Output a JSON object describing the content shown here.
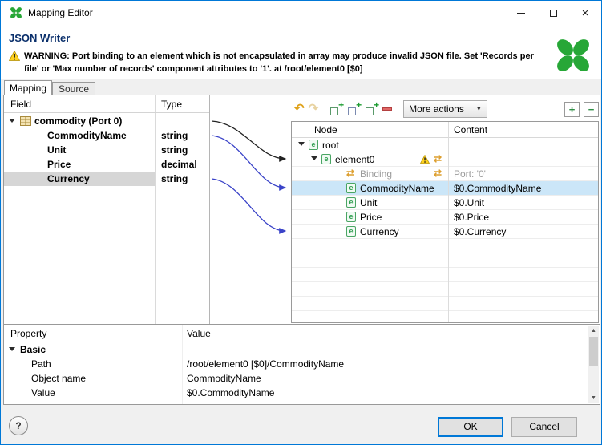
{
  "window": {
    "title": "Mapping Editor"
  },
  "header": {
    "title": "JSON Writer",
    "warning": "WARNING: Port binding to an element which is not encapsulated in array may produce invalid JSON file. Set 'Records per file' or 'Max number of records' component attributes to '1'. at /root/element0 [$0]"
  },
  "tabs": {
    "mapping": "Mapping",
    "source": "Source"
  },
  "left_table": {
    "col_field": "Field",
    "col_type": "Type",
    "root_label": "commodity (Port 0)",
    "rows": [
      {
        "field": "CommodityName",
        "type": "string"
      },
      {
        "field": "Unit",
        "type": "string"
      },
      {
        "field": "Price",
        "type": "decimal"
      },
      {
        "field": "Currency",
        "type": "string"
      }
    ]
  },
  "toolbar": {
    "more_actions": "More actions"
  },
  "tree": {
    "col_node": "Node",
    "col_content": "Content",
    "rows": [
      {
        "node": "root",
        "content": ""
      },
      {
        "node": "element0",
        "content": ""
      },
      {
        "node": "Binding",
        "content": "Port: '0'"
      },
      {
        "node": "CommodityName",
        "content": "$0.CommodityName"
      },
      {
        "node": "Unit",
        "content": "$0.Unit"
      },
      {
        "node": "Price",
        "content": "$0.Price"
      },
      {
        "node": "Currency",
        "content": "$0.Currency"
      }
    ]
  },
  "properties": {
    "col_property": "Property",
    "col_value": "Value",
    "group": "Basic",
    "rows": [
      {
        "property": "Path",
        "value": "/root/element0 [$0]/CommodityName"
      },
      {
        "property": "Object name",
        "value": "CommodityName"
      },
      {
        "property": "Value",
        "value": "$0.CommodityName"
      }
    ]
  },
  "footer": {
    "help": "?",
    "ok": "OK",
    "cancel": "Cancel"
  },
  "icons": {
    "element_glyph": "e",
    "binding_glyph": "⇄",
    "undo_glyph": "↶",
    "redo_glyph": "↷",
    "caret_down": "▼",
    "close_glyph": "×",
    "plus_glyph": "+",
    "minus_glyph": "−",
    "arrow_up": "▲",
    "arrow_down": "▼"
  },
  "colors": {
    "clover_green": "#27a737",
    "selection_blue": "#cbe6f8",
    "selection_gray": "#d6d6d6",
    "warning_yellow": "#ffd21e",
    "accent_blue": "#0078d7",
    "arrow_blue": "#3a43c8"
  }
}
